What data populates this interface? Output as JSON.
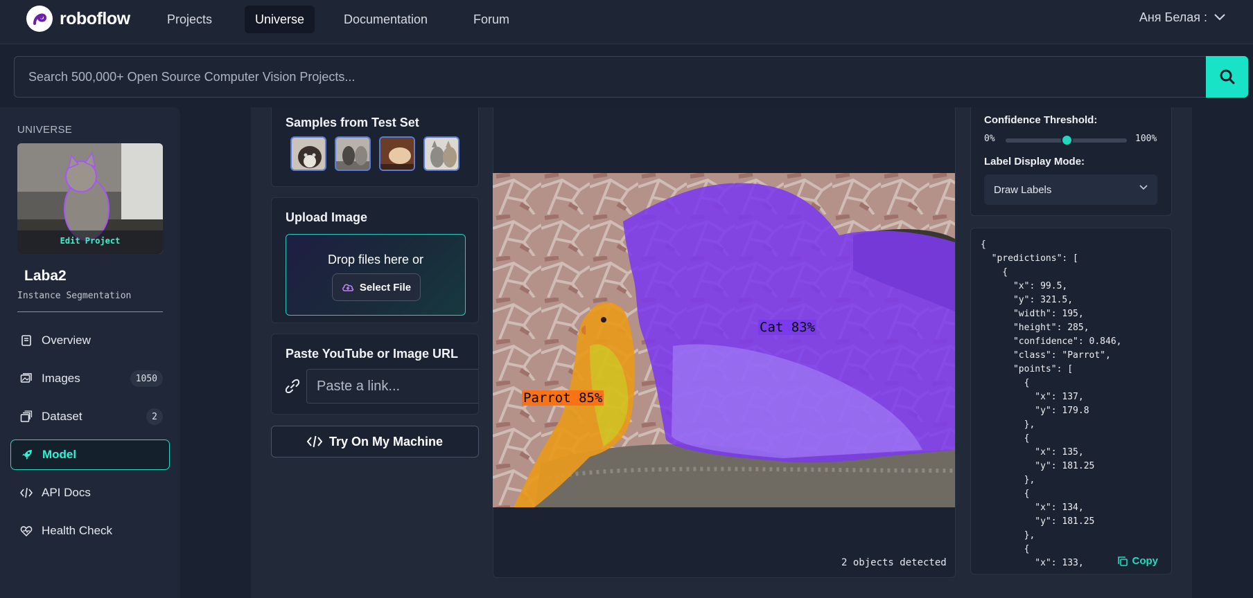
{
  "nav": {
    "brand": "roboflow",
    "links": [
      "Projects",
      "Universe",
      "Documentation",
      "Forum"
    ],
    "active": "Universe",
    "user": "Аня Белая :"
  },
  "search": {
    "placeholder": "Search 500,000+ Open Source Computer Vision Projects..."
  },
  "sidebar": {
    "section": "UNIVERSE",
    "edit_project": "Edit Project",
    "project_name": "Laba2",
    "project_type": "Instance Segmentation",
    "items": [
      {
        "label": "Overview",
        "icon": "book-icon"
      },
      {
        "label": "Images",
        "icon": "images-icon",
        "badge": "1050"
      },
      {
        "label": "Dataset",
        "icon": "layers-icon",
        "badge": "2"
      },
      {
        "label": "Model",
        "icon": "rocket-icon",
        "active": true
      },
      {
        "label": "API Docs",
        "icon": "code-icon"
      },
      {
        "label": "Health Check",
        "icon": "heart-pulse-icon"
      }
    ]
  },
  "samples": {
    "title": "Samples from Test Set"
  },
  "upload": {
    "title": "Upload Image",
    "drop_text": "Drop files here or",
    "select_label": "Select File"
  },
  "url": {
    "title": "Paste YouTube or Image URL",
    "placeholder": "Paste a link..."
  },
  "try_button": "Try On My Machine",
  "result": {
    "labels": [
      {
        "text": "Cat 83%",
        "color": "#7c3aed"
      },
      {
        "text": "Parrot 85%",
        "color": "#f97316"
      }
    ],
    "objects_detected": "2 objects detected"
  },
  "settings": {
    "confidence_label": "Confidence Threshold:",
    "min": "0%",
    "max": "100%",
    "confidence_value": 0.5,
    "label_mode_label": "Label Display Mode:",
    "label_mode_value": "Draw Labels"
  },
  "json_output": "{\n  \"predictions\": [\n    {\n      \"x\": 99.5,\n      \"y\": 321.5,\n      \"width\": 195,\n      \"height\": 285,\n      \"confidence\": 0.846,\n      \"class\": \"Parrot\",\n      \"points\": [\n        {\n          \"x\": 137,\n          \"y\": 179.8\n        },\n        {\n          \"x\": 135,\n          \"y\": 181.25\n        },\n        {\n          \"x\": 134,\n          \"y\": 181.25\n        },\n        {\n          \"x\": 133,",
  "copy_label": "Copy",
  "colors": {
    "accent": "#19e3c6",
    "cat_mask": "#7c3aed",
    "parrot_mask": "#f97316"
  }
}
